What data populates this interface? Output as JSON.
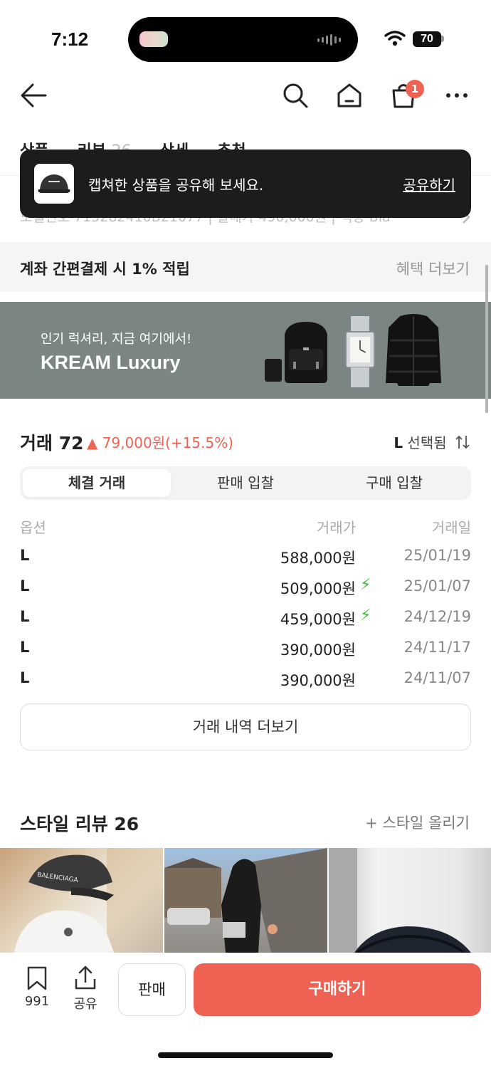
{
  "status": {
    "time": "7:12",
    "battery": "70"
  },
  "nav": {
    "cart_count": "1"
  },
  "tabs": [
    "상품",
    "리뷰",
    "26",
    "상세",
    "추천"
  ],
  "info_row": "모델번호 715282410B21077  |  발매가 490,000원  |  색상 Bla",
  "toast": {
    "text": "캡쳐한 상품을 공유해 보세요.",
    "link": "공유하기"
  },
  "benefit": {
    "label": "계좌 간편결제 시 1% 적립",
    "more": "혜택 더보기"
  },
  "banner": {
    "subtitle": "인기 럭셔리, 지금 여기에서!",
    "title": "KREAM Luxury"
  },
  "trades": {
    "title": "거래 72",
    "change": "▲ 79,000원(+15.5%)",
    "size_prefix": "L",
    "size_text": " 선택됨",
    "tabs": [
      "체결 거래",
      "판매 입찰",
      "구매 입찰"
    ],
    "headers": {
      "option": "옵션",
      "price": "거래가",
      "date": "거래일"
    },
    "rows": [
      {
        "size": "L",
        "price": "588,000원",
        "date": "25/01/19",
        "quick": false
      },
      {
        "size": "L",
        "price": "509,000원",
        "date": "25/01/07",
        "quick": true
      },
      {
        "size": "L",
        "price": "459,000원",
        "date": "24/12/19",
        "quick": true
      },
      {
        "size": "L",
        "price": "390,000원",
        "date": "24/11/17",
        "quick": false
      },
      {
        "size": "L",
        "price": "390,000원",
        "date": "24/11/07",
        "quick": false
      }
    ],
    "more": "거래 내역 더보기"
  },
  "style_review": {
    "title": "스타일 리뷰 26",
    "add": "+ 스타일 올리기",
    "cap_text": "BALENCIAGA"
  },
  "bottom": {
    "save_count": "991",
    "share_label": "공유",
    "sell_label": "판매",
    "buy_label": "구매하기"
  },
  "colors": {
    "accent": "#ef6253",
    "quick": "#3cbf3c",
    "banner_bg": "#7b8584"
  }
}
